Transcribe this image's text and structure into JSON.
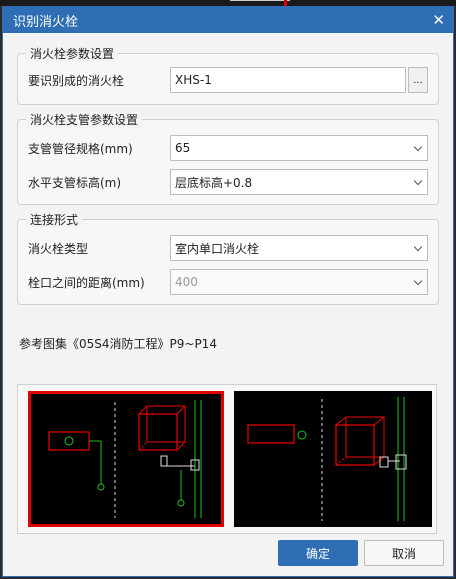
{
  "dialog": {
    "title": "识别消火栓"
  },
  "hydrant_params": {
    "legend": "消火栓参数设置",
    "label": "要识别成的消火栓",
    "value": "XHS-1",
    "browse_label": "..."
  },
  "branch_params": {
    "legend": "消火栓支管参数设置",
    "diameter_label": "支管管径规格(mm)",
    "diameter_value": "65",
    "elevation_label": "水平支管标高(m)",
    "elevation_value": "层底标高+0.8"
  },
  "connection": {
    "legend": "连接形式",
    "type_label": "消火栓类型",
    "type_value": "室内单口消火栓",
    "distance_label": "栓口之间的距离(mm)",
    "distance_value": "400"
  },
  "reference": "参考图集《05S4消防工程》P9~P14",
  "buttons": {
    "ok": "确定",
    "cancel": "取消"
  }
}
